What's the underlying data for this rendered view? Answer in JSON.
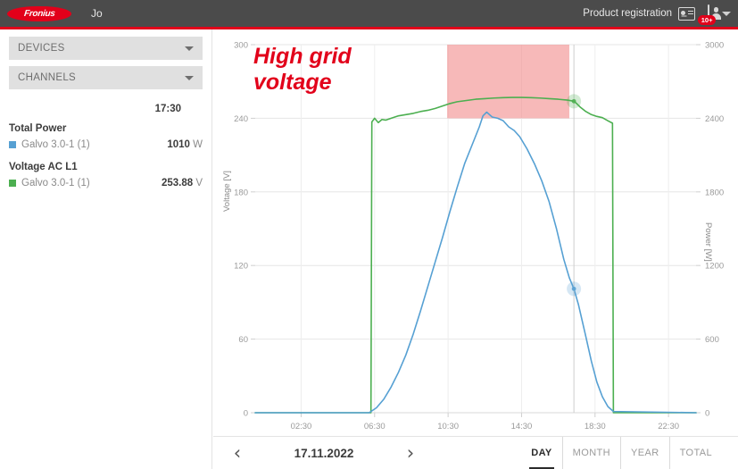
{
  "header": {
    "logo_text": "Fronius",
    "user_greeting": "Jo",
    "product_registration_label": "Product registration",
    "registration_icon": "registration-card-icon",
    "avatar_icon": "user-account-icon",
    "notification_badge": "10+",
    "dropdown_icon": "chevron-down-icon",
    "bar_color": "#4b4b4b",
    "accent_color": "#e2001a"
  },
  "sidebar": {
    "panels": [
      {
        "label": "DEVICES",
        "icon": "chevron-down-icon"
      },
      {
        "label": "CHANNELS",
        "icon": "chevron-down-icon"
      }
    ],
    "legend": {
      "time": "17:30",
      "groups": [
        {
          "title": "Total Power",
          "rows": [
            {
              "color": "#56a0d3",
              "name": "Galvo 3.0-1 (1)",
              "value": "1010",
              "unit": "W"
            }
          ]
        },
        {
          "title": "Voltage AC L1",
          "rows": [
            {
              "color": "#4caf50",
              "name": "Galvo 3.0-1 (1)",
              "value": "253.88",
              "unit": "V"
            }
          ]
        }
      ]
    }
  },
  "chart_annotation": "High grid\nvoltage",
  "bottombar": {
    "prev_icon": "chevron-left-icon",
    "next_icon": "chevron-right-icon",
    "date": "17.11.2022",
    "range_tabs": [
      {
        "label": "DAY",
        "active": true
      },
      {
        "label": "MONTH",
        "active": false
      },
      {
        "label": "YEAR",
        "active": false
      },
      {
        "label": "TOTAL",
        "active": false
      }
    ]
  },
  "chart_data": {
    "type": "line",
    "title": "",
    "xlabel": "",
    "x_ticks": [
      "02:30",
      "06:30",
      "10:30",
      "14:30",
      "18:30",
      "22:30"
    ],
    "x_tick_hours": [
      2.5,
      6.5,
      10.5,
      14.5,
      18.5,
      22.5
    ],
    "xlim_hours": [
      0,
      24
    ],
    "grid": true,
    "legend_position": "sidebar",
    "axes": [
      {
        "side": "left",
        "label": "Voltage [V]",
        "ticks": [
          0,
          60,
          120,
          180,
          240,
          300
        ],
        "ylim": [
          0,
          300
        ]
      },
      {
        "side": "right",
        "label": "Power [W]",
        "ticks": [
          0,
          600,
          1200,
          1800,
          2400,
          3000
        ],
        "ylim": [
          0,
          3000
        ]
      }
    ],
    "series": [
      {
        "name": "Voltage AC L1 - Galvo 3.0-1 (1)",
        "axis": "left",
        "unit": "V",
        "color": "#4caf50",
        "x": [
          0,
          6.3,
          6.35,
          6.5,
          6.7,
          6.9,
          7.1,
          7.4,
          7.8,
          8.2,
          8.6,
          9.0,
          9.4,
          9.8,
          10.2,
          10.6,
          11.0,
          11.5,
          12.0,
          12.5,
          13.0,
          13.5,
          14.0,
          14.5,
          15.0,
          15.5,
          16.0,
          16.5,
          17.0,
          17.35,
          17.5,
          17.7,
          18.0,
          18.3,
          18.6,
          18.9,
          19.2,
          19.45,
          19.5,
          24
        ],
        "y": [
          0,
          0,
          237,
          240,
          236.5,
          239,
          238.5,
          240,
          242,
          243,
          244,
          245.5,
          246.5,
          248,
          250,
          252,
          253.5,
          254.5,
          255.5,
          256,
          256.5,
          256.8,
          257,
          257,
          256.8,
          256.5,
          256,
          255.5,
          254.8,
          253.88,
          252,
          249,
          245.5,
          243,
          241.5,
          240.5,
          238,
          236,
          0,
          0
        ]
      },
      {
        "name": "Total Power - Galvo 3.0-1 (1)",
        "axis": "right",
        "unit": "W",
        "color": "#56a0d3",
        "x": [
          0,
          6.2,
          6.6,
          7.0,
          7.4,
          7.8,
          8.2,
          8.6,
          9.0,
          9.4,
          9.8,
          10.2,
          10.6,
          11.0,
          11.4,
          11.8,
          12.2,
          12.4,
          12.6,
          12.9,
          13.2,
          13.5,
          13.8,
          14.1,
          14.4,
          14.8,
          15.2,
          15.6,
          16.0,
          16.4,
          16.8,
          17.1,
          17.35,
          17.6,
          18.0,
          18.3,
          18.6,
          18.9,
          19.2,
          19.5,
          24
        ],
        "y": [
          0,
          0,
          40,
          110,
          210,
          330,
          470,
          640,
          830,
          1030,
          1230,
          1430,
          1640,
          1840,
          2030,
          2180,
          2330,
          2420,
          2450,
          2410,
          2400,
          2380,
          2330,
          2300,
          2250,
          2150,
          2030,
          1890,
          1720,
          1500,
          1250,
          1100,
          1010,
          880,
          620,
          420,
          250,
          130,
          50,
          10,
          0
        ]
      }
    ],
    "highlight_region": {
      "label": "high grid voltage band",
      "color": "#f08080",
      "opacity": 0.55,
      "x_range_hours": [
        10.45,
        17.1
      ],
      "y_range_voltage": [
        240,
        300
      ]
    },
    "cursor": {
      "x_hour": 17.35,
      "markers": [
        {
          "series": "Total Power - Galvo 3.0-1 (1)",
          "value": 1010,
          "unit": "W",
          "color": "#56a0d3"
        },
        {
          "series": "Voltage AC L1 - Galvo 3.0-1 (1)",
          "value": 253.88,
          "unit": "V",
          "color": "#4caf50"
        }
      ]
    }
  }
}
